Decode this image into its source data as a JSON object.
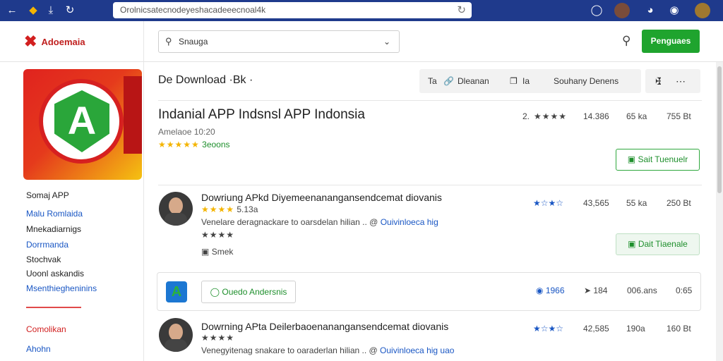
{
  "browser": {
    "url": "Orolnicsatecnodeyeshacadeeecnoal4k",
    "icons": [
      "back-icon",
      "extension-icon",
      "download-icon",
      "refresh-icon"
    ]
  },
  "header": {
    "logo_text": "Adoemaia",
    "search_value": "Snauga",
    "action_label": "Penguaes"
  },
  "sidebar": {
    "items": [
      {
        "label": "Somaj APP",
        "style": "dark"
      },
      {
        "label": "Malu Romlaida",
        "style": "blue"
      },
      {
        "label": "Mnekadiarnigs",
        "style": "dark"
      },
      {
        "label": "Dorrmanda",
        "style": "blue"
      },
      {
        "label": "Stochvak",
        "style": "dark"
      },
      {
        "label": "Uoonl askandis",
        "style": "dark"
      },
      {
        "label": "Msenthiegheninins",
        "style": "blue"
      }
    ],
    "bottom_items": [
      {
        "label": "Comolikan",
        "style": "red"
      },
      {
        "label": "Ahohn",
        "style": "blue"
      }
    ]
  },
  "toolbar": {
    "title": "De Download ·Bk ·",
    "group": [
      "Ta",
      "Dleanan",
      "Ia",
      "Souhany Denens"
    ]
  },
  "app": {
    "title": "Indanial APP Indsnsl APP Indonsia",
    "subtitle": "Amelaoe 10:20",
    "stars": "★★★★★",
    "rating_text": "3eoons",
    "stats": {
      "rank": "2.",
      "stars": "★★★★",
      "downloads": "14.386",
      "size": "65 ka",
      "count": "755 Bt"
    },
    "button": "Sait Tuenuelr"
  },
  "rows": [
    {
      "title": "Dowriung APkd Diyemeenanangansendcemat diovanis",
      "stars": "★★★★",
      "rating_text": "5.13a",
      "text": "Venelare deragnackare to oarsdelan hilian .. @",
      "link": "Ouivinloeca hig",
      "stars2": "★★★★",
      "tag": "Smek",
      "stats": {
        "stars": "★☆★☆",
        "downloads": "43,565",
        "size": "55 ka",
        "count": "250 Bt"
      },
      "button": "Dait Tiaenale"
    },
    {
      "title": "Dowrning APta Deilerbaoenanangansendcemat diovanis",
      "stars": "★★★★",
      "text": "Venegyitenag snakare to oaraderlan hilian .. @",
      "link": "Ouivinloeca hig uao",
      "stats": {
        "stars": "★☆★☆",
        "downloads": "42,585",
        "size": "190a",
        "count": "160 Bt"
      }
    }
  ],
  "card": {
    "button": "Ouedo Andersnis",
    "stats": {
      "likes": "1966",
      "shares": "184",
      "size": "006.ans",
      "count": "0:65"
    }
  },
  "colors": {
    "topbar": "#1f3a8c",
    "accent": "#1fa42e",
    "link": "#1a57c4",
    "star": "#f4b400"
  }
}
